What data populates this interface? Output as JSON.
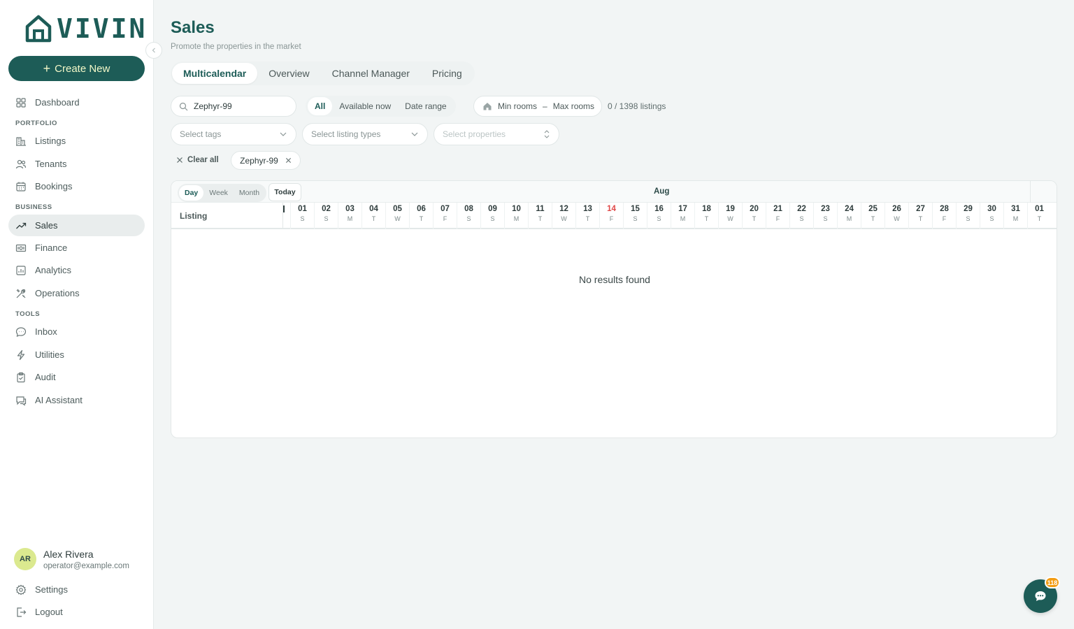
{
  "brand": {
    "name": "VIVIN",
    "accent": "#1d5c57"
  },
  "sidebar": {
    "create_label": "Create New",
    "sections": {
      "portfolio": "PORTFOLIO",
      "business": "BUSINESS",
      "tools": "TOOLS"
    },
    "items": [
      {
        "label": "Dashboard",
        "icon": "grid-icon"
      },
      {
        "label": "Listings",
        "icon": "building-icon"
      },
      {
        "label": "Tenants",
        "icon": "users-icon"
      },
      {
        "label": "Bookings",
        "icon": "calendar-icon"
      },
      {
        "label": "Sales",
        "icon": "trend-icon",
        "active": true
      },
      {
        "label": "Finance",
        "icon": "money-icon"
      },
      {
        "label": "Analytics",
        "icon": "chart-icon"
      },
      {
        "label": "Operations",
        "icon": "tools-icon"
      },
      {
        "label": "Inbox",
        "icon": "chat-icon"
      },
      {
        "label": "Utilities",
        "icon": "bolt-icon"
      },
      {
        "label": "Audit",
        "icon": "clipboard-icon"
      },
      {
        "label": "AI Assistant",
        "icon": "ai-chat-icon"
      }
    ],
    "user": {
      "initials": "AR",
      "name": "Alex Rivera",
      "email": "operator@example.com"
    },
    "settings_label": "Settings",
    "logout_label": "Logout"
  },
  "header": {
    "title": "Sales",
    "subtitle": "Promote the properties in the market",
    "tabs": [
      "Multicalendar",
      "Overview",
      "Channel Manager",
      "Pricing"
    ]
  },
  "filters": {
    "search_value": "Zephyr-99",
    "availability": [
      "All",
      "Available now",
      "Date range"
    ],
    "min_rooms": "Min rooms",
    "rooms_sep": "–",
    "max_rooms": "Max rooms",
    "count": "0 / 1398 listings",
    "select_tags": "Select tags",
    "select_types": "Select listing types",
    "select_properties": "Select properties",
    "clear_all": "Clear all",
    "chip": "Zephyr-99"
  },
  "calendar": {
    "views": [
      "Day",
      "Week",
      "Month"
    ],
    "today_label": "Today",
    "month": "Aug",
    "listing_header": "Listing",
    "days": [
      {
        "n": "01",
        "w": "S"
      },
      {
        "n": "02",
        "w": "S"
      },
      {
        "n": "03",
        "w": "M"
      },
      {
        "n": "04",
        "w": "T"
      },
      {
        "n": "05",
        "w": "W"
      },
      {
        "n": "06",
        "w": "T"
      },
      {
        "n": "07",
        "w": "F"
      },
      {
        "n": "08",
        "w": "S"
      },
      {
        "n": "09",
        "w": "S"
      },
      {
        "n": "10",
        "w": "M"
      },
      {
        "n": "11",
        "w": "T"
      },
      {
        "n": "12",
        "w": "W"
      },
      {
        "n": "13",
        "w": "T"
      },
      {
        "n": "14",
        "w": "F",
        "today": true
      },
      {
        "n": "15",
        "w": "S"
      },
      {
        "n": "16",
        "w": "S"
      },
      {
        "n": "17",
        "w": "M"
      },
      {
        "n": "18",
        "w": "T"
      },
      {
        "n": "19",
        "w": "W"
      },
      {
        "n": "20",
        "w": "T"
      },
      {
        "n": "21",
        "w": "F"
      },
      {
        "n": "22",
        "w": "S"
      },
      {
        "n": "23",
        "w": "S"
      },
      {
        "n": "24",
        "w": "M"
      },
      {
        "n": "25",
        "w": "T"
      },
      {
        "n": "26",
        "w": "W"
      },
      {
        "n": "27",
        "w": "T"
      },
      {
        "n": "28",
        "w": "F"
      },
      {
        "n": "29",
        "w": "S"
      },
      {
        "n": "30",
        "w": "S"
      },
      {
        "n": "31",
        "w": "M"
      },
      {
        "n": "01",
        "w": "T"
      }
    ],
    "empty_text": "No results found"
  },
  "chat": {
    "badge": "118"
  }
}
